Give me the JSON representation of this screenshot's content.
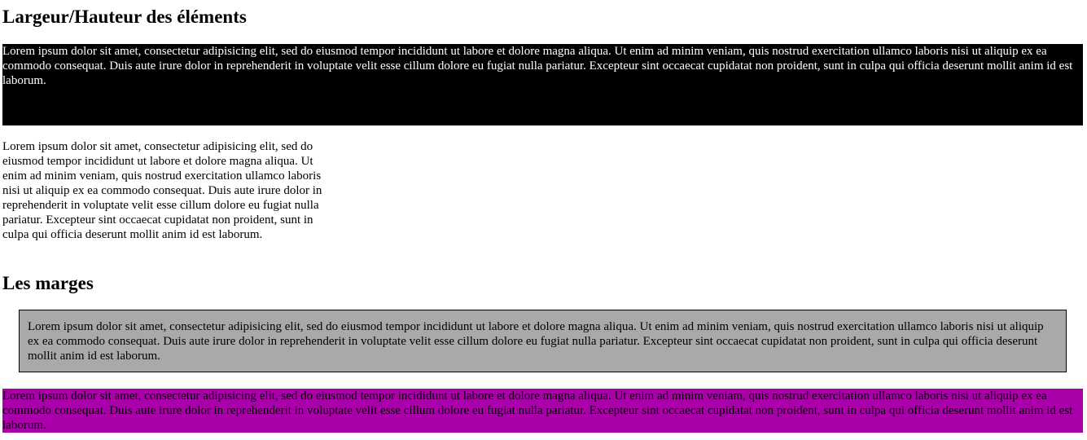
{
  "sections": {
    "dimensions_title": "Largeur/Hauteur des éléments",
    "margins_title": "Les marges"
  },
  "paragraphs": {
    "black_block": "Lorem ipsum dolor sit amet, consectetur adipisicing elit, sed do eiusmod tempor incididunt ut labore et dolore magna aliqua. Ut enim ad minim veniam, quis nostrud exercitation ullamco laboris nisi ut aliquip ex ea commodo consequat. Duis aute irure dolor in reprehenderit in voluptate velit esse cillum dolore eu fugiat nulla pariatur. Excepteur sint occaecat cupidatat non proident, sunt in culpa qui officia deserunt mollit anim id est laborum.",
    "narrow_block": "Lorem ipsum dolor sit amet, consectetur adipisicing elit, sed do eiusmod tempor incididunt ut labore et dolore magna aliqua. Ut enim ad minim veniam, quis nostrud exercitation ullamco laboris nisi ut aliquip ex ea commodo consequat. Duis aute irure dolor in reprehenderit in voluptate velit esse cillum dolore eu fugiat nulla pariatur. Excepteur sint occaecat cupidatat non proident, sunt in culpa qui officia deserunt mollit anim id est laborum.",
    "gray_block": "Lorem ipsum dolor sit amet, consectetur adipisicing elit, sed do eiusmod tempor incididunt ut labore et dolore magna aliqua. Ut enim ad minim veniam, quis nostrud exercitation ullamco laboris nisi ut aliquip ex ea commodo consequat. Duis aute irure dolor in reprehenderit in voluptate velit esse cillum dolore eu fugiat nulla pariatur. Excepteur sint occaecat cupidatat non proident, sunt in culpa qui officia deserunt mollit anim id est laborum.",
    "magenta_block": "Lorem ipsum dolor sit amet, consectetur adipisicing elit, sed do eiusmod tempor incididunt ut labore et dolore magna aliqua. Ut enim ad minim veniam, quis nostrud exercitation ullamco laboris nisi ut aliquip ex ea commodo consequat. Duis aute irure dolor in reprehenderit in voluptate velit esse cillum dolore eu fugiat nulla pariatur. Excepteur sint occaecat cupidatat non proident, sunt in culpa qui officia deserunt mollit anim id est laborum."
  },
  "colors": {
    "black_block_bg": "#000000",
    "black_block_text": "#ffffff",
    "gray_block_bg": "#a9a9a9",
    "gray_block_border": "#000000",
    "magenta_block_bg": "#aa00aa"
  }
}
